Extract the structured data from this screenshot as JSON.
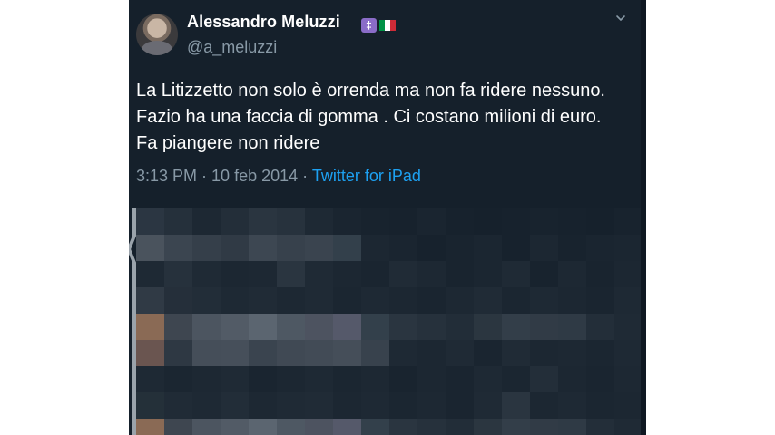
{
  "tweet": {
    "display_name": "Alessandro Meluzzi",
    "handle": "@a_meluzzi",
    "text": "La Litizzetto non solo è orrenda ma non fa ridere nessuno. Fazio ha una faccia di gomma . Ci costano milioni di euro. Fa piangere non ridere",
    "time": "3:13 PM",
    "separator": " · ",
    "date": "10 feb 2014",
    "separator2": " · ",
    "source": "Twitter for iPad",
    "badges": [
      "cross-badge-icon",
      "italy-flag-icon"
    ],
    "menu_icon": "chevron-down-icon"
  },
  "colors": {
    "background": "#15202b",
    "primary_text": "#ffffff",
    "secondary_text": "#8899a6",
    "link": "#1da1f2",
    "divider": "#38444d"
  },
  "redacted_area": {
    "description_icon": "pixelated-replies-region"
  }
}
